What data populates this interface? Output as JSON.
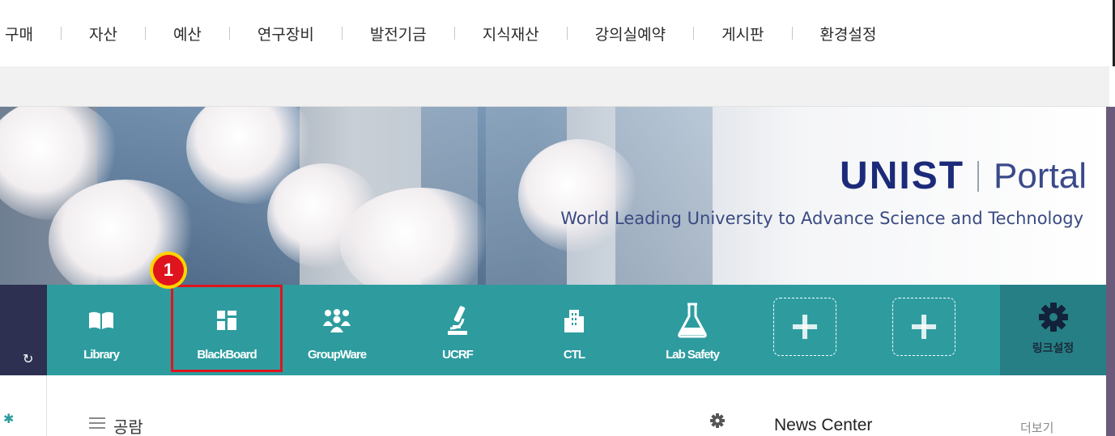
{
  "top_menu": [
    "구매",
    "자산",
    "예산",
    "연구장비",
    "발전기금",
    "지식재산",
    "강의실예약",
    "게시판",
    "환경설정"
  ],
  "banner": {
    "logo_text": "UNIST",
    "portal_label": "Portal",
    "tagline": "World Leading University to Advance Science and Technology"
  },
  "links": [
    {
      "label": "Library",
      "icon": "book-icon"
    },
    {
      "label": "BlackBoard",
      "icon": "blackboard-icon"
    },
    {
      "label": "GroupWare",
      "icon": "group-icon"
    },
    {
      "label": "UCRF",
      "icon": "microscope-icon"
    },
    {
      "label": "CTL",
      "icon": "building-icon"
    },
    {
      "label": "Lab Safety",
      "icon": "flask-icon"
    }
  ],
  "link_settings_label": "링크설정",
  "annotation_badge": "1",
  "colors": {
    "linkbar": "#2e9c9f",
    "highlight": "#e1141c",
    "badge": "#ffd400"
  },
  "bottom": {
    "left_section_title": "공람",
    "news_title": "News Center",
    "more_label": "더보기"
  }
}
